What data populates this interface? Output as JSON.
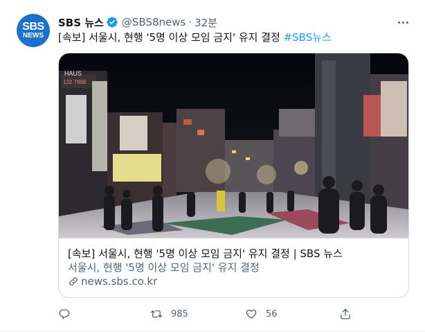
{
  "tweet": {
    "avatar": {
      "line1": "SBS",
      "line2": "NEWS"
    },
    "display_name": "SBS 뉴스",
    "handle": "@SBS8news",
    "separator": "·",
    "time": "32분",
    "text": "[속보] 서울시, 현행 '5명 이상 모임 금지' 유지 결정 ",
    "hashtag": "#SBS뉴스"
  },
  "card": {
    "image_sign": "HAUS",
    "image_phone": "132 7888",
    "title": "[속보] 서울시, 현행 '5명 이상 모임 금지' 유지 결정 | SBS 뉴스",
    "description": "서울시, 현행 '5명 이상 모임 금지' 유지 결정",
    "domain": "news.sbs.co.kr"
  },
  "actions": {
    "reply_count": "",
    "retweet_count": "985",
    "like_count": "56"
  },
  "colors": {
    "accent": "#1d9bf0",
    "avatar_bg": "#1a73c9",
    "secondary_text": "#536471",
    "border": "#cfd9de"
  },
  "icons": [
    "verified-badge-icon",
    "more-icon",
    "link-icon",
    "reply-icon",
    "retweet-icon",
    "like-icon",
    "share-icon"
  ]
}
